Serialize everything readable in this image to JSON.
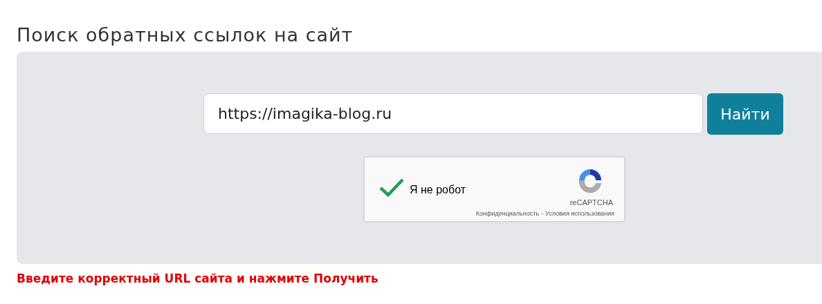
{
  "title": "Поиск обратных ссылок на сайт",
  "search": {
    "value": "https://imagika-blog.ru",
    "button": "Найти"
  },
  "captcha": {
    "checked": true,
    "label": "Я не робот",
    "brand": "reCAPTCHA",
    "privacy": "Конфиденциальность",
    "separator": "-",
    "terms": "Условия использования"
  },
  "hint": "Введите корректный URL сайта и нажмите Получить"
}
